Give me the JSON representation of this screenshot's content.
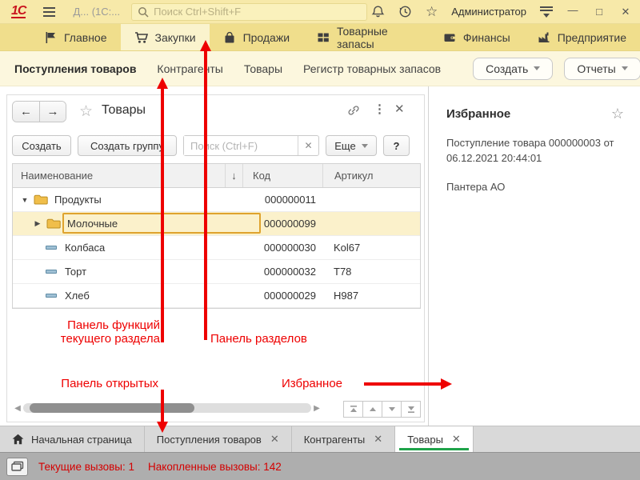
{
  "titlebar": {
    "logo": "1С",
    "window_title": "Д... (1С:...",
    "search_placeholder": "Поиск Ctrl+Shift+F",
    "user_name": "Администратор"
  },
  "section_panel": {
    "items": [
      {
        "label": "Главное",
        "icon": "flag-icon"
      },
      {
        "label": "Закупки",
        "icon": "cart-icon",
        "active": true
      },
      {
        "label": "Продажи",
        "icon": "bag-icon"
      },
      {
        "label": "Товарные запасы",
        "icon": "boxes-icon"
      },
      {
        "label": "Финансы",
        "icon": "wallet-icon"
      },
      {
        "label": "Предприятие",
        "icon": "factory-icon"
      }
    ]
  },
  "function_panel": {
    "links": [
      {
        "label": "Поступления товаров",
        "active": true
      },
      {
        "label": "Контрагенты"
      },
      {
        "label": "Товары"
      },
      {
        "label": "Регистр товарных запасов"
      }
    ],
    "buttons": [
      {
        "label": "Создать"
      },
      {
        "label": "Отчеты"
      }
    ]
  },
  "list_window": {
    "title": "Товары",
    "toolbar": {
      "create": "Создать",
      "create_group": "Создать группу",
      "search_placeholder": "Поиск (Ctrl+F)",
      "more": "Еще",
      "help": "?"
    },
    "table": {
      "columns": [
        "Наименование",
        "Код",
        "Артикул"
      ],
      "sort_indicator": "↓",
      "rows": [
        {
          "type": "group",
          "name": "Продукты",
          "code": "000000011",
          "article": ""
        },
        {
          "type": "group",
          "name": "Молочные",
          "code": "000000099",
          "article": "",
          "selected": true
        },
        {
          "type": "item",
          "name": "Колбаса",
          "code": "000000030",
          "article": "Kol67"
        },
        {
          "type": "item",
          "name": "Торт",
          "code": "000000032",
          "article": "T78"
        },
        {
          "type": "item",
          "name": "Хлеб",
          "code": "000000029",
          "article": "H987"
        }
      ]
    }
  },
  "favorites_panel": {
    "title": "Избранное",
    "items": [
      "Поступление товара 000000003 от 06.12.2021 20:44:01",
      "Пантера АО"
    ]
  },
  "taskbar": {
    "tabs": [
      {
        "label": "Начальная страница",
        "icon": "home-icon"
      },
      {
        "label": "Поступления товаров",
        "closable": true
      },
      {
        "label": "Контрагенты",
        "closable": true
      },
      {
        "label": "Товары",
        "closable": true,
        "active": true
      }
    ]
  },
  "statusbar": {
    "current_calls": "Текущие вызовы: 1",
    "accumulated_calls": "Накопленные вызовы: 142"
  },
  "annotations": {
    "func_label_line1": "Панель функций",
    "func_label_line2": "текущего раздела",
    "sections_label": "Панель разделов",
    "open_label": "Панель открытых",
    "favorites_label": "Избранное",
    "color": "#ee0000"
  },
  "colors": {
    "titlebar_bg": "#f7e9a9",
    "section_bar_bg": "#f0de8c",
    "section_active_bg": "#faf3cd",
    "function_panel_bg": "#fcf7de",
    "selected_row_bg": "#fbf1cb",
    "selection_border": "#dfa32e",
    "active_tab_underline": "#1fa34a",
    "annotation_red": "#ee0000",
    "status_text_red": "#d40000"
  }
}
